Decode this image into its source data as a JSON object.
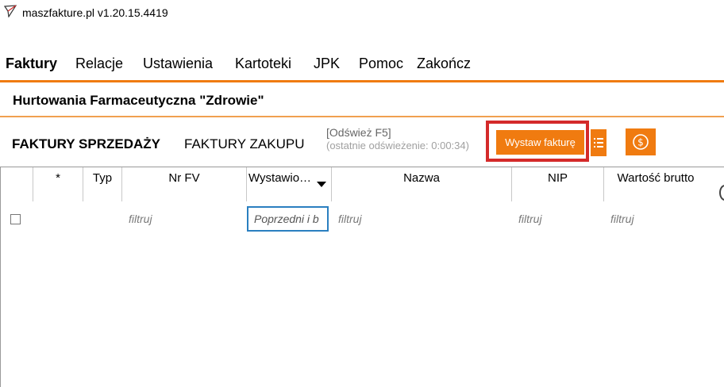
{
  "app": {
    "title": "maszfakture.pl  v1.20.15.4419",
    "icon": "paper-plane-icon"
  },
  "menu": {
    "items": [
      {
        "label": "Faktury",
        "active": true
      },
      {
        "label": "Relacje",
        "active": false
      },
      {
        "label": "Ustawienia",
        "active": false
      },
      {
        "label": "Kartoteki",
        "active": false
      },
      {
        "label": "JPK",
        "active": false
      },
      {
        "label": "Pomoc",
        "active": false
      },
      {
        "label": "Zakończ",
        "active": false
      }
    ]
  },
  "company": {
    "name": "Hurtowania Farmaceutyczna \"Zdrowie\""
  },
  "tabs": [
    {
      "label": "FAKTURY SPRZEDAŻY",
      "active": true
    },
    {
      "label": "FAKTURY ZAKUPU",
      "active": false
    }
  ],
  "refresh": {
    "label": "[Odśwież F5]",
    "last": "(ostatnie odświeżenie: 0:00:34)"
  },
  "toolbar": {
    "issue_invoice_label": "Wystaw fakturę",
    "list_icon": "list-icon",
    "money_icon": "dollar-coin-icon"
  },
  "colors": {
    "accent": "#f07b10",
    "highlight": "#d42a2a",
    "focus": "#2a7fc0"
  },
  "grid": {
    "headers": [
      "*",
      "Typ",
      "Nr FV",
      "Wystawio…",
      "Nazwa",
      "NIP",
      "Wartość brutto"
    ],
    "filters": {
      "nr_fv": "filtruj",
      "date": "Poprzedni i b",
      "nazwa": "filtruj",
      "nip": "filtruj",
      "wartosc": "filtruj"
    }
  }
}
